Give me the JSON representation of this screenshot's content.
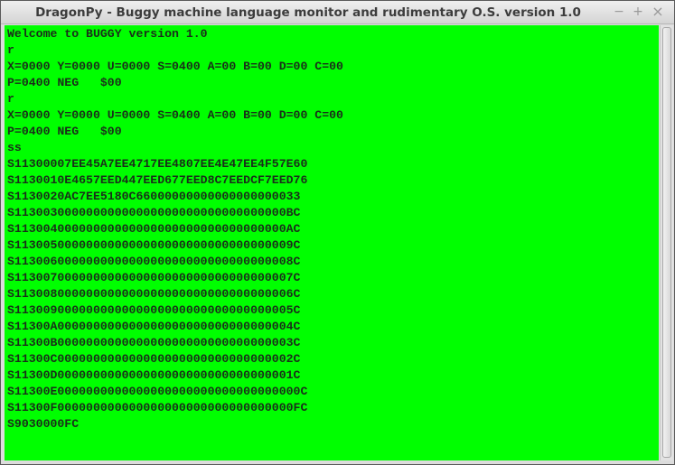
{
  "window": {
    "title": "DragonPy - Buggy machine language monitor and rudimentary O.S. version 1.0",
    "minimize_glyph": "−",
    "maximize_glyph": "+",
    "close_glyph": "×"
  },
  "terminal": {
    "background_color": "#00ff00",
    "text_color": "#1a2e1a",
    "lines": [
      "Welcome to BUGGY version 1.0",
      "r",
      "X=0000 Y=0000 U=0000 S=0400 A=00 B=00 D=00 C=00",
      "P=0400 NEG   $00",
      "r",
      "X=0000 Y=0000 U=0000 S=0400 A=00 B=00 D=00 C=00",
      "P=0400 NEG   $00",
      "ss",
      "S11300007EE45A7EE4717EE4807EE4E47EE4F57E60",
      "S1130010E4657EED447EED677EED8C7EEDCF7EED76",
      "S1130020AC7EE5180C66000000000000000000033",
      "S11300300000000000000000000000000000000BC",
      "S11300400000000000000000000000000000000AC",
      "S113005000000000000000000000000000000009C",
      "S113006000000000000000000000000000000008C",
      "S113007000000000000000000000000000000007C",
      "S113008000000000000000000000000000000006C",
      "S113009000000000000000000000000000000005C",
      "S11300A000000000000000000000000000000004C",
      "S11300B000000000000000000000000000000003C",
      "S11300C000000000000000000000000000000002C",
      "S11300D000000000000000000000000000000001C",
      "S11300E0000000000000000000000000000000000C",
      "S11300F000000000000000000000000000000000FC",
      "S9030000FC"
    ]
  }
}
